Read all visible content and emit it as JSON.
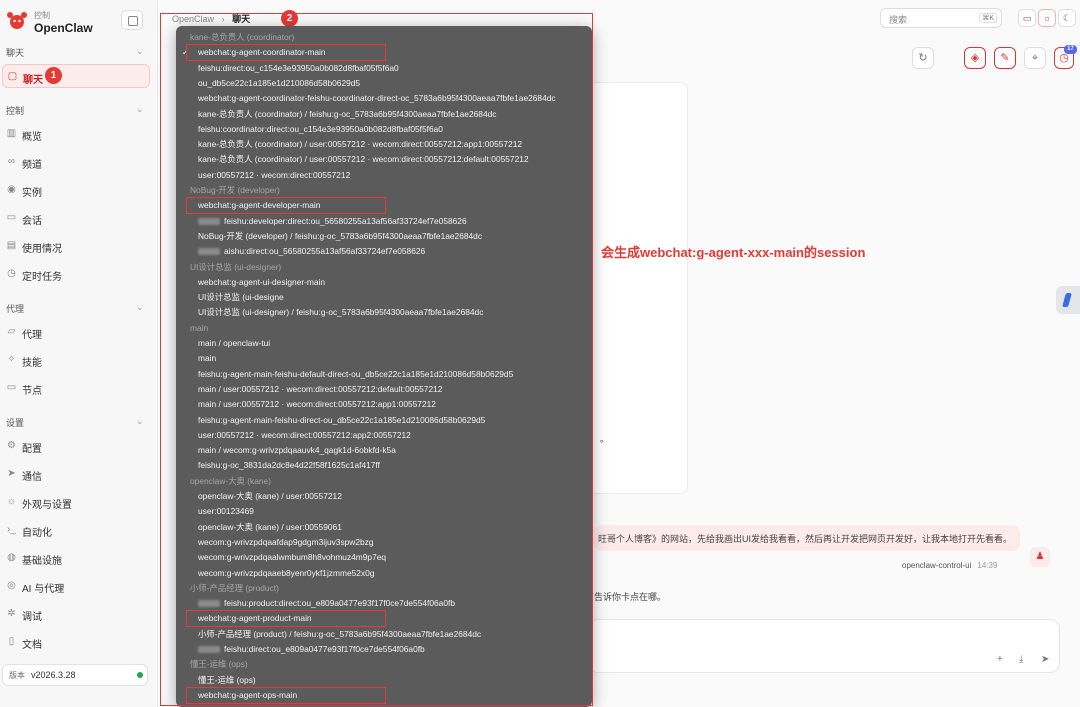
{
  "brand": {
    "subtitle": "控制",
    "name": "OpenClaw"
  },
  "sidebar": {
    "sections": [
      {
        "title": "聊天",
        "items": [
          {
            "label": "聊天",
            "icon": "chat-icon",
            "active": true
          }
        ]
      },
      {
        "title": "控制",
        "items": [
          {
            "label": "概览",
            "icon": "chart-icon"
          },
          {
            "label": "频道",
            "icon": "link-icon"
          },
          {
            "label": "实例",
            "icon": "radio-icon"
          },
          {
            "label": "会话",
            "icon": "file-icon"
          },
          {
            "label": "使用情况",
            "icon": "bar-chart-icon"
          },
          {
            "label": "定时任务",
            "icon": "clock-icon"
          }
        ]
      },
      {
        "title": "代理",
        "items": [
          {
            "label": "代理",
            "icon": "folder-icon"
          },
          {
            "label": "技能",
            "icon": "spark-icon"
          },
          {
            "label": "节点",
            "icon": "monitor-icon"
          }
        ]
      },
      {
        "title": "设置",
        "items": [
          {
            "label": "配置",
            "icon": "gear-icon"
          },
          {
            "label": "通信",
            "icon": "send-icon"
          },
          {
            "label": "外观与设置",
            "icon": "sun-icon"
          },
          {
            "label": "自动化",
            "icon": "terminal-icon"
          },
          {
            "label": "基础设施",
            "icon": "globe-icon"
          },
          {
            "label": "AI 与代理",
            "icon": "ai-icon"
          },
          {
            "label": "调试",
            "icon": "bug-icon"
          }
        ]
      }
    ],
    "docs_label": "文档",
    "version_label": "版本",
    "version": "v2026.3.28"
  },
  "annotations": {
    "badge1": "1",
    "badge2": "2",
    "note": "会生成webchat:g-agent-xxx-main的session"
  },
  "breadcrumb": {
    "root": "OpenClaw",
    "sep": "›",
    "current": "聊天"
  },
  "search": {
    "placeholder": "搜索",
    "shortcut": "⌘K"
  },
  "header_badge": "17",
  "chat": {
    "user_message": "旺哥个人博客》的网站，先给我画出UI发给我看看，然后再让开发把网页开发好，让我本地打开先看看。",
    "sender": "openclaw-control-ui",
    "time": "14:39",
    "reply_fragment": "告诉你卡点在哪。",
    "mid_fragment": "。"
  },
  "session_list": [
    {
      "type": "group",
      "text": "kane-总负责人 (coordinator)"
    },
    {
      "type": "item",
      "text": "webchat:g-agent-coordinator-main",
      "selected": true,
      "highlight": true
    },
    {
      "type": "item",
      "text": "feishu:direct:ou_c154e3e93950a0b082d8fbaf05f5f6a0"
    },
    {
      "type": "item",
      "text": "ou_db5ce22c1a185e1d210086d58b0629d5"
    },
    {
      "type": "item",
      "text": "webchat:g-agent-coordinator-feishu-coordinator-direct-oc_5783a6b95f4300aeaa7fbfe1ae2684dc"
    },
    {
      "type": "item",
      "text": "kane-总负责人 (coordinator) / feishu:g-oc_5783a6b95f4300aeaa7fbfe1ae2684dc"
    },
    {
      "type": "item",
      "text": "feishu:coordinator:direct:ou_c154e3e93950a0b082d8fbaf05f5f6a0"
    },
    {
      "type": "item",
      "text": "kane-总负责人 (coordinator) / user:00557212 · wecom:direct:00557212:app1:00557212"
    },
    {
      "type": "item",
      "text": "kane-总负责人 (coordinator) / user:00557212 · wecom:direct:00557212:default:00557212"
    },
    {
      "type": "item",
      "text": "user:00557212 · wecom:direct:00557212"
    },
    {
      "type": "group",
      "text": "NoBug-开发 (developer)"
    },
    {
      "type": "item",
      "text": "webchat:g-agent-developer-main",
      "highlight": true
    },
    {
      "type": "item",
      "text": "feishu:developer:direct:ou_56580255a13af56af33724ef7e058626",
      "blur_prefix": true
    },
    {
      "type": "item",
      "text": "NoBug-开发 (developer) / feishu:g-oc_5783a6b95f4300aeaa7fbfe1ae2684dc"
    },
    {
      "type": "item",
      "text": "aishu:direct:ou_56580255a13af56af33724ef7e058626",
      "blur_prefix": true
    },
    {
      "type": "group",
      "text": "UI设计总监 (ui-designer)"
    },
    {
      "type": "item",
      "text": "webchat:g-agent-ui-designer-main"
    },
    {
      "type": "item",
      "text": "UI设计总监 (ui-designe"
    },
    {
      "type": "item",
      "text": "UI设计总监 (ui-designer) / feishu:g-oc_5783a6b95f4300aeaa7fbfe1ae2684dc"
    },
    {
      "type": "group",
      "text": "main"
    },
    {
      "type": "item",
      "text": "main / openclaw-tui"
    },
    {
      "type": "item",
      "text": "main"
    },
    {
      "type": "item",
      "text": "feishu:g-agent-main-feishu-default-direct-ou_db5ce22c1a185e1d210086d58b0629d5"
    },
    {
      "type": "item",
      "text": "main / user:00557212 · wecom:direct:00557212:default:00557212"
    },
    {
      "type": "item",
      "text": "main / user:00557212 · wecom:direct:00557212:app1:00557212"
    },
    {
      "type": "item",
      "text": "feishu:g-agent-main-feishu-direct-ou_db5ce22c1a185e1d210086d58b0629d5"
    },
    {
      "type": "item",
      "text": "user:00557212 · wecom:direct:00557212:app2:00557212"
    },
    {
      "type": "item",
      "text": "main / wecom:g-wrivzpdqaauvk4_qagk1d-6obkfd-k5a"
    },
    {
      "type": "item",
      "text": "feishu:g-oc_3831da2dc8e4d22f58f1625c1af417ff"
    },
    {
      "type": "group",
      "text": "openclaw-大奥 (kane)"
    },
    {
      "type": "item",
      "text": "openclaw-大奥 (kane) / user:00557212"
    },
    {
      "type": "item",
      "text": "user:00123469"
    },
    {
      "type": "item",
      "text": "openclaw-大奥 (kane) / user:00559061"
    },
    {
      "type": "item",
      "text": "wecom:g-wrivzpdqaafdap9gdgm3ijuv3spw2bzg"
    },
    {
      "type": "item",
      "text": "wecom:g-wrivzpdqaalwmbum8h8vohmuz4m9p7eq"
    },
    {
      "type": "item",
      "text": "wecom:g-wrivzpdqaaeb8yenr0ykf1jzmme52x0g"
    },
    {
      "type": "group",
      "text": "小师-产品经理 (product)"
    },
    {
      "type": "item",
      "text": "feishu:product:direct:ou_e809a0477e93f17f0ce7de554f06a0fb",
      "blur_prefix": true
    },
    {
      "type": "item",
      "text": "webchat:g-agent-product-main",
      "highlight": true
    },
    {
      "type": "item",
      "text": "小师-产品经理 (product) / feishu:g-oc_5783a6b95f4300aeaa7fbfe1ae2684dc"
    },
    {
      "type": "item",
      "text": "feishu:direct:ou_e809a0477e93f17f0ce7de554f06a0fb",
      "blur_prefix": true
    },
    {
      "type": "group",
      "text": "懂王-运维 (ops)"
    },
    {
      "type": "item",
      "text": "懂王-运维 (ops)"
    },
    {
      "type": "item",
      "text": "webchat:g-agent-ops-main",
      "highlight": true
    }
  ],
  "colors": {
    "accent": "#e53935",
    "dropdown_bg": "#5b5b5b"
  }
}
